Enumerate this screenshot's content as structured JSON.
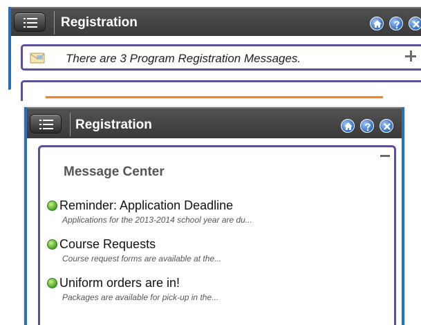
{
  "panels": {
    "collapsed": {
      "title": "Registration",
      "notice_text": "There are 3 Program Registration Messages."
    },
    "expanded": {
      "title": "Registration",
      "heading": "Message Center",
      "messages": [
        {
          "title": "Reminder: Application Deadline",
          "preview": "Applications for the 2013-2014 school year are du..."
        },
        {
          "title": "Course Requests",
          "preview": "Course request forms are available at the..."
        },
        {
          "title": "Uniform orders are in!",
          "preview": "Packages are available for pick-up in the..."
        }
      ]
    }
  },
  "icons": {
    "menu": "menu-icon",
    "home": "home-icon",
    "help": "help-icon",
    "close": "close-icon",
    "envelope": "envelope-icon",
    "expand": "plus-icon",
    "collapse": "minus-icon",
    "status": "green-dot-icon"
  },
  "colors": {
    "titlebar": "#3f3f3f",
    "accent_blue": "#2a6fb7",
    "panel_border": "#5b4f98",
    "divider": "#f08a1e",
    "status_green": "#4aa11f"
  }
}
